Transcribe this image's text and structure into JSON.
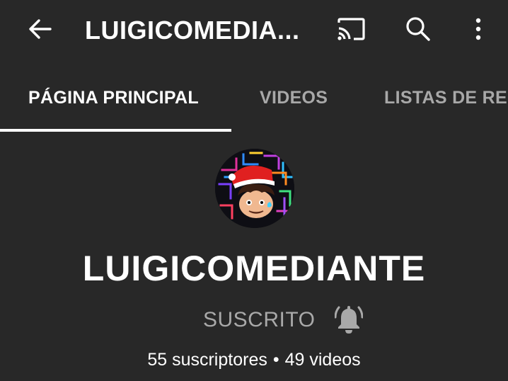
{
  "header": {
    "title": "LUIGICOMEDIA...",
    "back_icon": "arrow-left-icon",
    "cast_icon": "cast-icon",
    "search_icon": "search-icon",
    "more_icon": "more-vert-icon"
  },
  "tabs": [
    {
      "label": "PÁGINA PRINCIPAL",
      "active": true
    },
    {
      "label": "VIDEOS",
      "active": false
    },
    {
      "label": "LISTAS DE RE",
      "active": false
    }
  ],
  "channel": {
    "name": "LUIGICOMEDIANTE",
    "subscription_status": "SUSCRITO",
    "notification_icon": "bell-icon",
    "subscribers": "55 suscriptores",
    "separator": "•",
    "videos": "49 videos"
  },
  "colors": {
    "background": "#282828",
    "text_primary": "#ffffff",
    "text_secondary": "#a8a8a8",
    "hat_red": "#e02020"
  }
}
